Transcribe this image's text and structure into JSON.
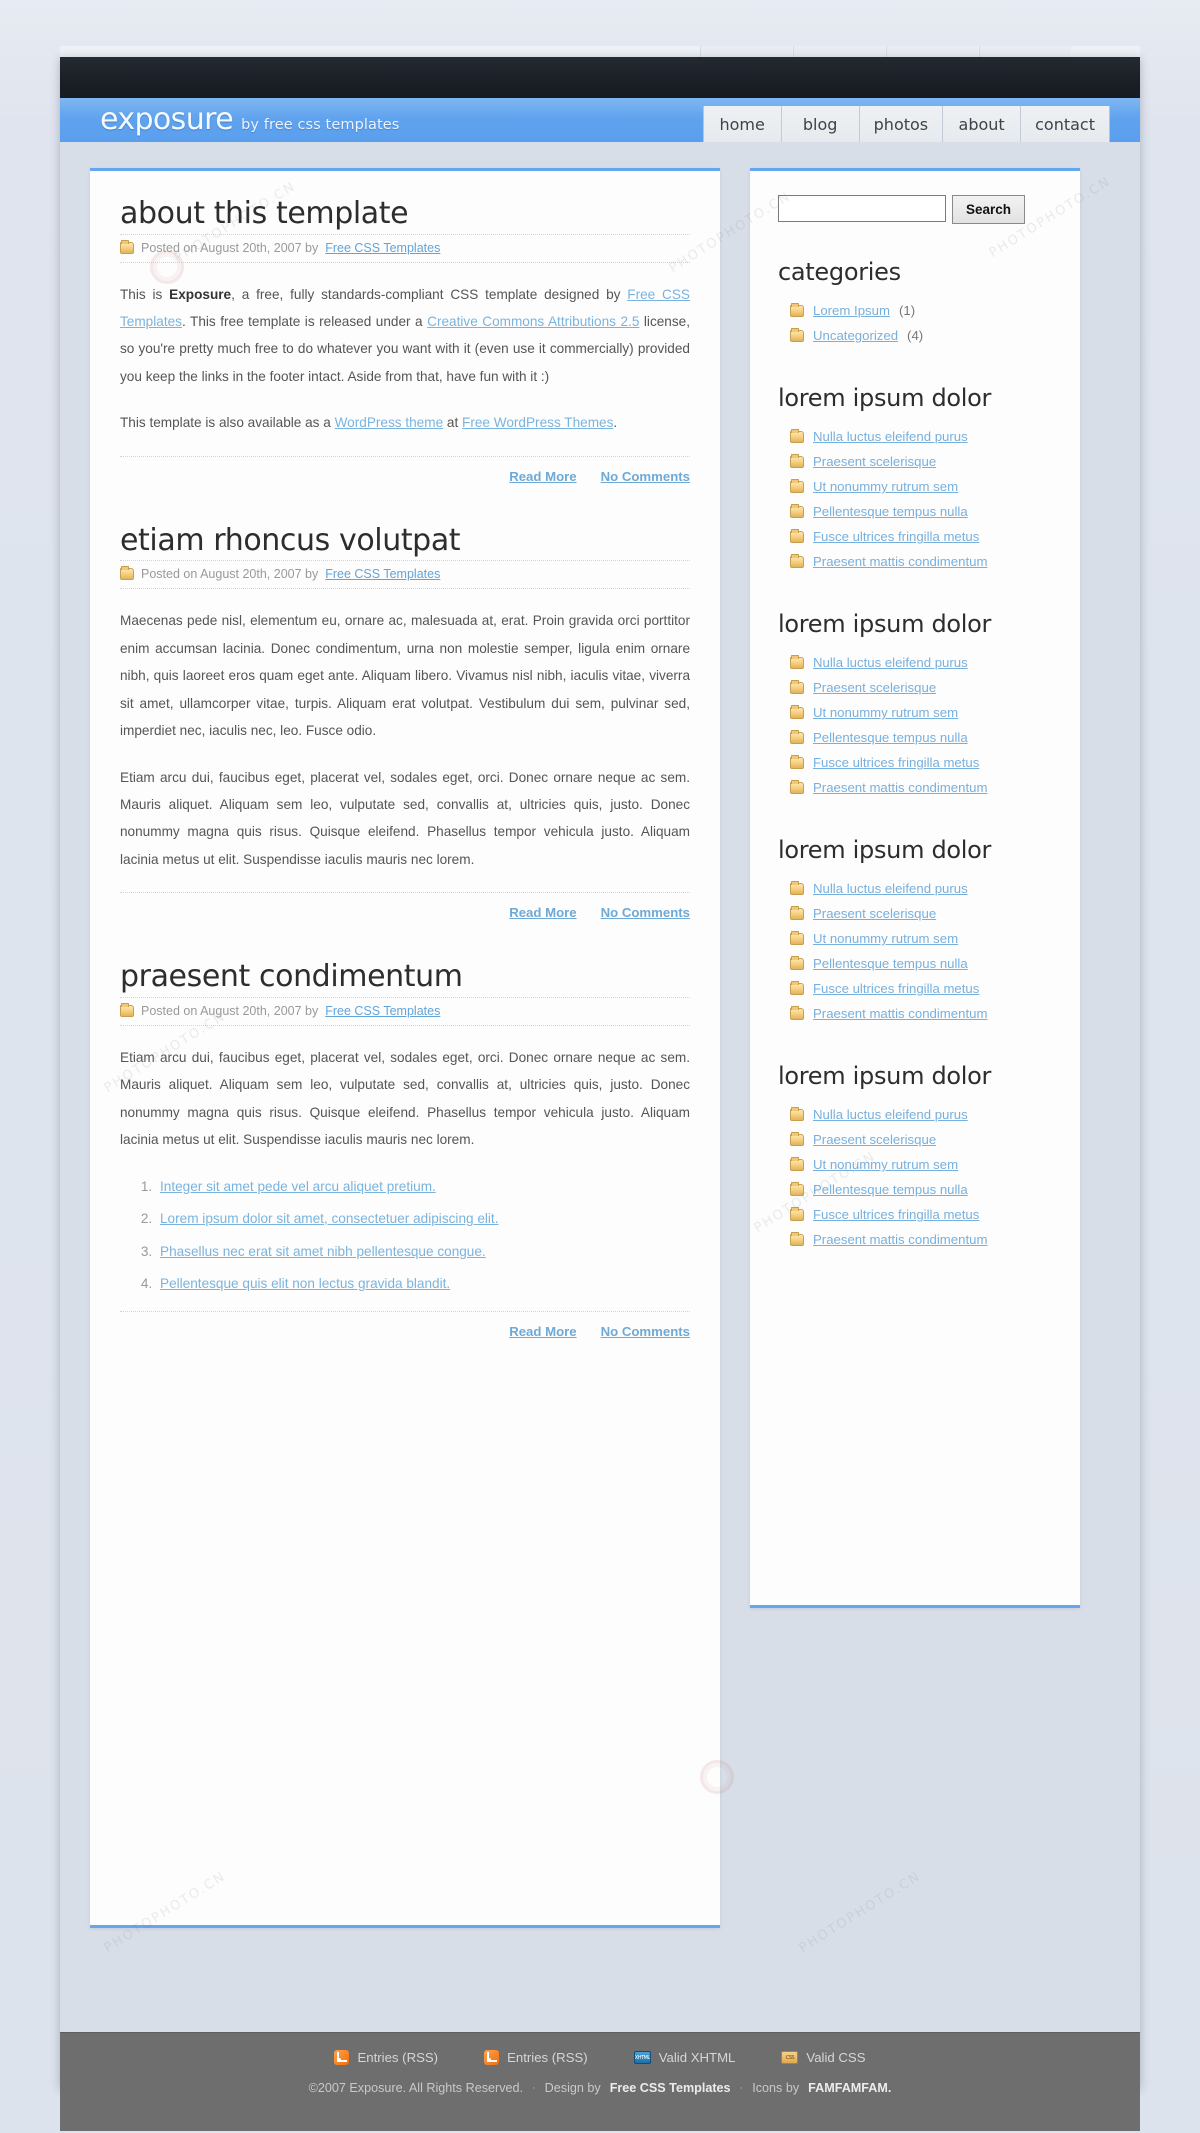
{
  "site": {
    "brand": "exposure",
    "tagline": "by free css templates"
  },
  "nav": {
    "items": [
      {
        "label": "home"
      },
      {
        "label": "blog"
      },
      {
        "label": "photos"
      },
      {
        "label": "about"
      },
      {
        "label": "contact"
      }
    ]
  },
  "search": {
    "value": "",
    "placeholder": "",
    "button_label": "Search"
  },
  "posts": [
    {
      "title": "about this template",
      "meta_prefix": "Posted on August 20th, 2007 by",
      "meta_author": "Free CSS Templates",
      "paragraphs": [
        "This is Exposure, a free, fully standards-compliant CSS template designed by Free CSS Templates. This free template is released under a Creative Commons Attributions 2.5 license, so you're pretty much free to do whatever you want with it (even use it commercially) provided you keep the links in the footer intact. Aside from that, have fun with it :)",
        "This template is also available as a WordPress theme at Free WordPress Themes."
      ],
      "read_more": "Read More",
      "comments": "No Comments"
    },
    {
      "title": "etiam rhoncus volutpat",
      "meta_prefix": "Posted on August 20th, 2007 by",
      "meta_author": "Free CSS Templates",
      "paragraphs": [
        "Maecenas pede nisl, elementum eu, ornare ac, malesuada at, erat. Proin gravida orci porttitor enim accumsan lacinia. Donec condimentum, urna non molestie semper, ligula enim ornare nibh, quis laoreet eros quam eget ante. Aliquam libero. Vivamus nisl nibh, iaculis vitae, viverra sit amet, ullamcorper vitae, turpis. Aliquam erat volutpat. Vestibulum dui sem, pulvinar sed, imperdiet nec, iaculis nec, leo. Fusce odio.",
        "Etiam arcu dui, faucibus eget, placerat vel, sodales eget, orci. Donec ornare neque ac sem. Mauris aliquet. Aliquam sem leo, vulputate sed, convallis at, ultricies quis, justo. Donec nonummy magna quis risus. Quisque eleifend. Phasellus tempor vehicula justo. Aliquam lacinia metus ut elit. Suspendisse iaculis mauris nec lorem."
      ],
      "read_more": "Read More",
      "comments": "No Comments"
    },
    {
      "title": "praesent condimentum",
      "meta_prefix": "Posted on August 20th, 2007 by",
      "meta_author": "Free CSS Templates",
      "paragraphs": [
        "Etiam arcu dui, faucibus eget, placerat vel, sodales eget, orci. Donec ornare neque ac sem. Mauris aliquet. Aliquam sem leo, vulputate sed, convallis at, ultricies quis, justo. Donec nonummy magna quis risus. Quisque eleifend. Phasellus tempor vehicula justo. Aliquam lacinia metus ut elit. Suspendisse iaculis mauris nec lorem."
      ],
      "list": [
        "Integer sit amet pede vel arcu aliquet pretium.",
        "Lorem ipsum dolor sit amet, consectetuer adipiscing elit.",
        "Phasellus nec erat sit amet nibh pellentesque congue.",
        "Pellentesque quis elit non lectus gravida blandit."
      ],
      "read_more": "Read More",
      "comments": "No Comments"
    }
  ],
  "sidebar": {
    "categories": {
      "title": "categories",
      "items": [
        {
          "label": "Lorem Ipsum",
          "count": "(1)"
        },
        {
          "label": "Uncategorized",
          "count": "(4)"
        }
      ]
    },
    "link_blocks": [
      {
        "title": "lorem ipsum dolor",
        "items": [
          "Nulla luctus eleifend purus",
          "Praesent scelerisque",
          "Ut nonummy rutrum sem",
          "Pellentesque tempus nulla",
          "Fusce ultrices fringilla metus",
          "Praesent mattis condimentum"
        ]
      },
      {
        "title": "lorem ipsum dolor",
        "items": [
          "Nulla luctus eleifend purus",
          "Praesent scelerisque",
          "Ut nonummy rutrum sem",
          "Pellentesque tempus nulla",
          "Fusce ultrices fringilla metus",
          "Praesent mattis condimentum"
        ]
      },
      {
        "title": "lorem ipsum dolor",
        "items": [
          "Nulla luctus eleifend purus",
          "Praesent scelerisque",
          "Ut nonummy rutrum sem",
          "Pellentesque tempus nulla",
          "Fusce ultrices fringilla metus",
          "Praesent mattis condimentum"
        ]
      },
      {
        "title": "lorem ipsum dolor",
        "items": [
          "Nulla luctus eleifend purus",
          "Praesent scelerisque",
          "Ut nonummy rutrum sem",
          "Pellentesque tempus nulla",
          "Fusce ultrices fringilla metus",
          "Praesent mattis condimentum"
        ]
      }
    ]
  },
  "footer": {
    "links": [
      {
        "label": "Entries (RSS)",
        "icon": "rss-icon"
      },
      {
        "label": "Entries (RSS)",
        "icon": "rss-icon"
      },
      {
        "label": "Valid XHTML",
        "icon": "xhtml-badge-icon"
      },
      {
        "label": "Valid CSS",
        "icon": "css-badge-icon"
      }
    ],
    "icon_labels": {
      "xhtml": "XHTML",
      "css": "CSS"
    },
    "copyright": "©2007 Exposure. All Rights Reserved.",
    "design_prefix": "Design by",
    "design_by": "Free CSS Templates",
    "icons_prefix": "Icons by",
    "icons_by": "FAMFAMFAM.",
    "separator": "·"
  },
  "theme": {
    "accent_blue": "#64a6ef",
    "header_blue": "#5fa2ee",
    "topbar_dark": "#1b2027",
    "footer_gray": "#6e6e6e",
    "link_blue": "#7ab4de",
    "page_bg": "#d8dee8"
  }
}
